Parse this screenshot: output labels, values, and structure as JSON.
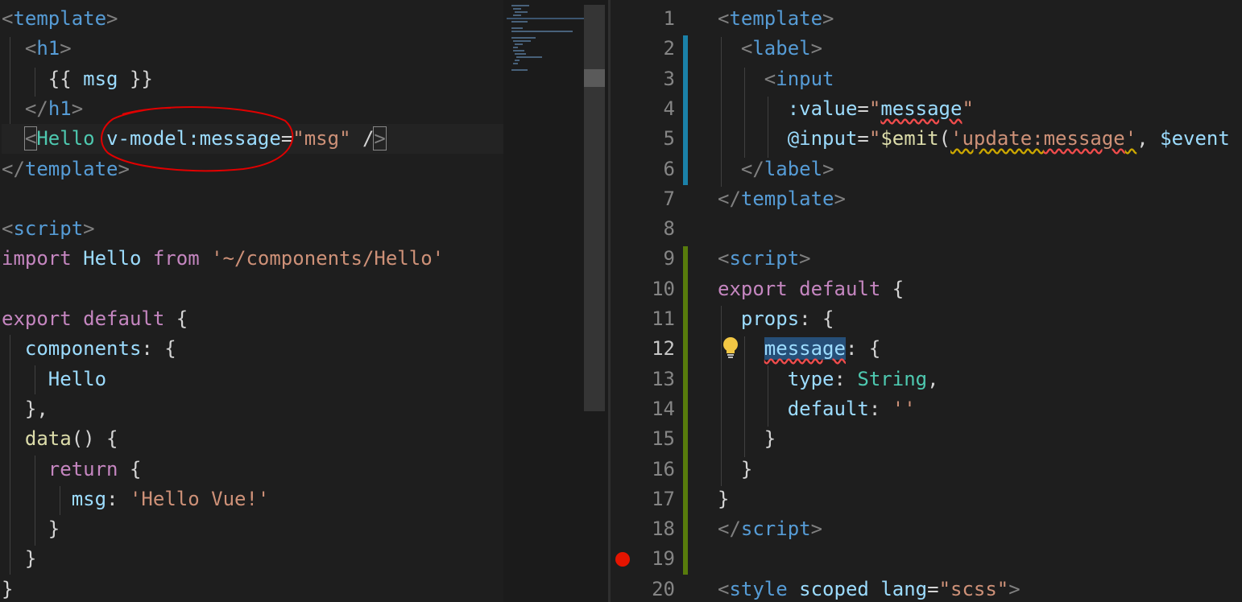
{
  "left_editor": {
    "lines": [
      [
        [
          "tk-punct",
          "<"
        ],
        [
          "tk-tag",
          "template"
        ],
        [
          "tk-punct",
          ">"
        ]
      ],
      [
        [
          "tk-text",
          "  "
        ],
        [
          "tk-punct",
          "<"
        ],
        [
          "tk-tag",
          "h1"
        ],
        [
          "tk-punct",
          ">"
        ]
      ],
      [
        [
          "tk-text",
          "    "
        ],
        [
          "tk-text",
          "{{ "
        ],
        [
          "tk-name",
          "msg"
        ],
        [
          "tk-text",
          " }}"
        ]
      ],
      [
        [
          "tk-text",
          "  "
        ],
        [
          "tk-punct",
          "</"
        ],
        [
          "tk-tag",
          "h1"
        ],
        [
          "tk-punct",
          ">"
        ]
      ],
      [
        [
          "tk-text",
          "  "
        ],
        [
          "tk-punct bracket-box",
          "<"
        ],
        [
          "tk-comp",
          "Hello"
        ],
        [
          "tk-text",
          " "
        ],
        [
          "tk-attr",
          "v-model:message"
        ],
        [
          "tk-text",
          "="
        ],
        [
          "tk-str",
          "\"msg\""
        ],
        [
          "tk-text",
          " /"
        ],
        [
          "tk-punct bracket-box",
          ">"
        ]
      ],
      [
        [
          "tk-punct",
          "</"
        ],
        [
          "tk-tag",
          "template"
        ],
        [
          "tk-punct",
          ">"
        ]
      ],
      [],
      [
        [
          "tk-punct",
          "<"
        ],
        [
          "tk-tag",
          "script"
        ],
        [
          "tk-punct",
          ">"
        ]
      ],
      [
        [
          "tk-keyword",
          "import"
        ],
        [
          "tk-text",
          " "
        ],
        [
          "tk-name",
          "Hello"
        ],
        [
          "tk-text",
          " "
        ],
        [
          "tk-keyword",
          "from"
        ],
        [
          "tk-text",
          " "
        ],
        [
          "tk-str",
          "'~/components/Hello'"
        ]
      ],
      [],
      [
        [
          "tk-keyword",
          "export"
        ],
        [
          "tk-text",
          " "
        ],
        [
          "tk-keyword",
          "default"
        ],
        [
          "tk-text",
          " {"
        ]
      ],
      [
        [
          "tk-text",
          "  "
        ],
        [
          "tk-name",
          "components"
        ],
        [
          "tk-text",
          ": {"
        ]
      ],
      [
        [
          "tk-text",
          "    "
        ],
        [
          "tk-name",
          "Hello"
        ]
      ],
      [
        [
          "tk-text",
          "  },"
        ]
      ],
      [
        [
          "tk-text",
          "  "
        ],
        [
          "tk-fn",
          "data"
        ],
        [
          "tk-text",
          "() {"
        ]
      ],
      [
        [
          "tk-text",
          "    "
        ],
        [
          "tk-keyword",
          "return"
        ],
        [
          "tk-text",
          " {"
        ]
      ],
      [
        [
          "tk-text",
          "      "
        ],
        [
          "tk-name",
          "msg"
        ],
        [
          "tk-text",
          ": "
        ],
        [
          "tk-str",
          "'Hello Vue!'"
        ]
      ],
      [
        [
          "tk-text",
          "    }"
        ]
      ],
      [
        [
          "tk-text",
          "  }"
        ]
      ],
      [
        [
          "tk-text",
          "}"
        ]
      ]
    ]
  },
  "right_editor": {
    "line_numbers": [
      "1",
      "2",
      "3",
      "4",
      "5",
      "6",
      "7",
      "8",
      "9",
      "10",
      "11",
      "12",
      "13",
      "14",
      "15",
      "16",
      "17",
      "18",
      "19",
      "20"
    ],
    "active_line": "12",
    "lines": [
      [
        [
          "tk-punct",
          "<"
        ],
        [
          "tk-tag",
          "template"
        ],
        [
          "tk-punct",
          ">"
        ]
      ],
      [
        [
          "tk-text",
          "  "
        ],
        [
          "tk-punct",
          "<"
        ],
        [
          "tk-tag",
          "label"
        ],
        [
          "tk-punct",
          ">"
        ]
      ],
      [
        [
          "tk-text",
          "    "
        ],
        [
          "tk-punct",
          "<"
        ],
        [
          "tk-tag",
          "input"
        ]
      ],
      [
        [
          "tk-text",
          "      "
        ],
        [
          "tk-attr",
          ":value"
        ],
        [
          "tk-text",
          "="
        ],
        [
          "tk-str",
          "\""
        ],
        [
          "tk-name underline-red",
          "message"
        ],
        [
          "tk-str",
          "\""
        ]
      ],
      [
        [
          "tk-text",
          "      "
        ],
        [
          "tk-attr",
          "@input"
        ],
        [
          "tk-text",
          "="
        ],
        [
          "tk-str",
          "\""
        ],
        [
          "tk-fn",
          "$emit"
        ],
        [
          "tk-text",
          "("
        ],
        [
          "tk-str underline-yellow",
          "'update:"
        ],
        [
          "tk-str underline-red",
          "message"
        ],
        [
          "tk-str underline-yellow",
          "'"
        ],
        [
          "tk-text",
          ", "
        ],
        [
          "tk-name",
          "$event"
        ]
      ],
      [
        [
          "tk-text",
          "  "
        ],
        [
          "tk-punct",
          "</"
        ],
        [
          "tk-tag",
          "label"
        ],
        [
          "tk-punct",
          ">"
        ]
      ],
      [
        [
          "tk-punct",
          "</"
        ],
        [
          "tk-tag",
          "template"
        ],
        [
          "tk-punct",
          ">"
        ]
      ],
      [],
      [
        [
          "tk-punct",
          "<"
        ],
        [
          "tk-tag",
          "script"
        ],
        [
          "tk-punct",
          ">"
        ]
      ],
      [
        [
          "tk-keyword",
          "export"
        ],
        [
          "tk-text",
          " "
        ],
        [
          "tk-keyword",
          "default"
        ],
        [
          "tk-text",
          " {"
        ]
      ],
      [
        [
          "tk-text",
          "  "
        ],
        [
          "tk-name",
          "props"
        ],
        [
          "tk-text",
          ": {"
        ]
      ],
      [
        [
          "tk-text",
          "    "
        ],
        [
          "tk-name highlight-word underline-red",
          "message"
        ],
        [
          "tk-text",
          ": {"
        ]
      ],
      [
        [
          "tk-text",
          "      "
        ],
        [
          "tk-name",
          "type"
        ],
        [
          "tk-text",
          ": "
        ],
        [
          "tk-type",
          "String"
        ],
        [
          "tk-text",
          ","
        ]
      ],
      [
        [
          "tk-text",
          "      "
        ],
        [
          "tk-name",
          "default"
        ],
        [
          "tk-text",
          ": "
        ],
        [
          "tk-str",
          "''"
        ]
      ],
      [
        [
          "tk-text",
          "    }"
        ]
      ],
      [
        [
          "tk-text",
          "  }"
        ]
      ],
      [
        [
          "tk-text",
          "}"
        ]
      ],
      [
        [
          "tk-punct",
          "</"
        ],
        [
          "tk-tag",
          "script"
        ],
        [
          "tk-punct",
          ">"
        ]
      ],
      [],
      [
        [
          "tk-punct",
          "<"
        ],
        [
          "tk-tag",
          "style"
        ],
        [
          "tk-text",
          " "
        ],
        [
          "tk-attr",
          "scoped"
        ],
        [
          "tk-text",
          " "
        ],
        [
          "tk-attr",
          "lang"
        ],
        [
          "tk-text",
          "="
        ],
        [
          "tk-str",
          "\"scss\""
        ],
        [
          "tk-punct",
          ">"
        ]
      ]
    ]
  },
  "icons": {
    "breakpoint": "breakpoint-icon",
    "lightbulb": "lightbulb-icon"
  },
  "colors": {
    "annotation": "#e00000",
    "breakpoint": "#e51400",
    "bulb": "#f2c744"
  }
}
